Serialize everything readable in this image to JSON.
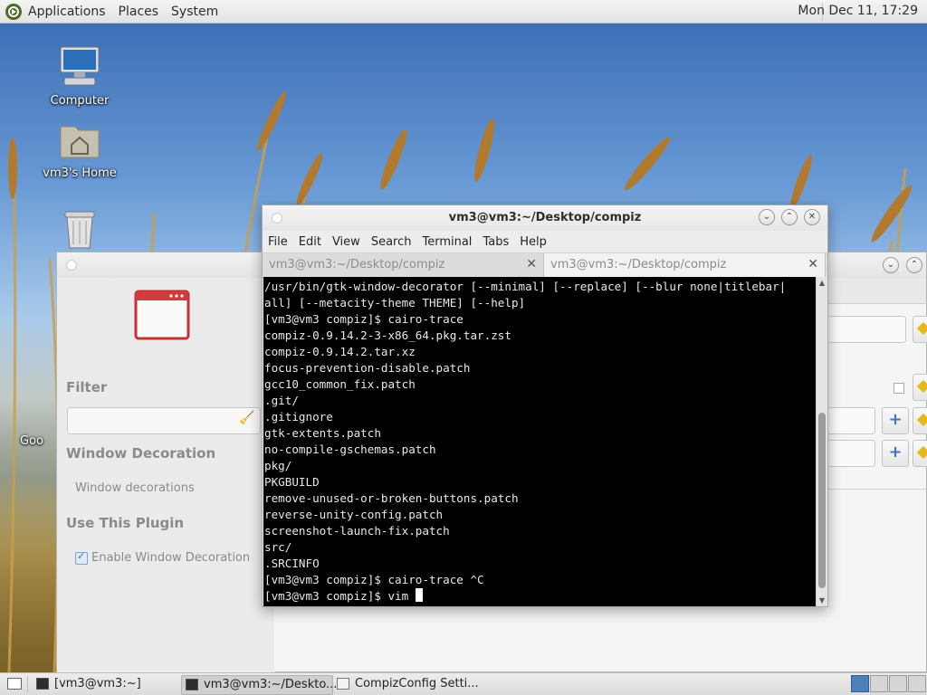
{
  "top_panel": {
    "menus": [
      "Applications",
      "Places",
      "System"
    ],
    "clock": "Mon Dec 11, 17:29"
  },
  "desktop": {
    "icons": [
      {
        "label": "Computer",
        "icon": "computer-icon"
      },
      {
        "label": "vm3's Home",
        "icon": "home-folder-icon"
      },
      {
        "label": "",
        "icon": "trash-icon"
      }
    ],
    "partial_text": "Goo"
  },
  "ccsm": {
    "filter_heading": "Filter",
    "filter_value": "",
    "plugin_heading": "Window Decoration",
    "plugin_description": "Window decorations",
    "use_heading": "Use This Plugin",
    "enable_label": "Enable Window Decoration",
    "enable_checked": true
  },
  "terminal": {
    "title": "vm3@vm3:~/Desktop/compiz",
    "menu": [
      "File",
      "Edit",
      "View",
      "Search",
      "Terminal",
      "Tabs",
      "Help"
    ],
    "tabs": [
      {
        "label": "vm3@vm3:~/Desktop/compiz",
        "active": false
      },
      {
        "label": "vm3@vm3:~/Desktop/compiz",
        "active": true
      }
    ],
    "lines": [
      "/usr/bin/gtk-window-decorator [--minimal] [--replace] [--blur none|titlebar|",
      "all] [--metacity-theme THEME] [--help]",
      "[vm3@vm3 compiz]$ cairo-trace",
      "compiz-0.9.14.2-3-x86_64.pkg.tar.zst",
      "compiz-0.9.14.2.tar.xz",
      "focus-prevention-disable.patch",
      "gcc10_common_fix.patch",
      ".git/",
      ".gitignore",
      "gtk-extents.patch",
      "no-compile-gschemas.patch",
      "pkg/",
      "PKGBUILD",
      "remove-unused-or-broken-buttons.patch",
      "reverse-unity-config.patch",
      "screenshot-launch-fix.patch",
      "src/",
      ".SRCINFO",
      "[vm3@vm3 compiz]$ cairo-trace ^C"
    ],
    "prompt_line": "[vm3@vm3 compiz]$ vim "
  },
  "bottom_panel": {
    "tasks": [
      {
        "label": "[vm3@vm3:~]",
        "active": false
      },
      {
        "label": "vm3@vm3:~/Deskto...",
        "active": true
      },
      {
        "label": "CompizConfig Setti...",
        "active": false
      }
    ]
  }
}
